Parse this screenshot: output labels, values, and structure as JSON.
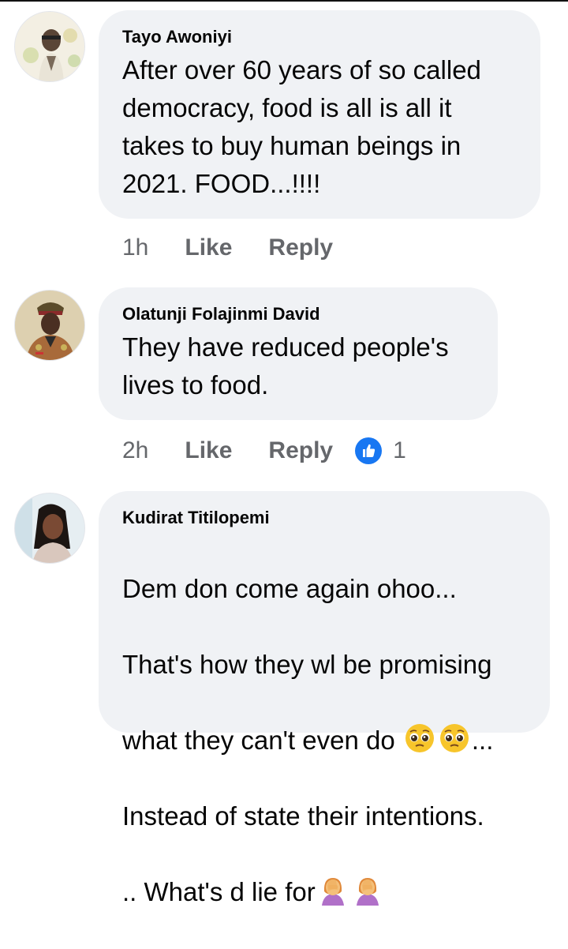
{
  "comments": [
    {
      "author": "Tayo Awoniyi",
      "text": "After over 60 years of so called\ndemocracy, food is all is all it\ntakes to buy human beings in\n2021. FOOD...!!!!",
      "time": "1h",
      "like_label": "Like",
      "reply_label": "Reply"
    },
    {
      "author": "Olatunji Folajinmi David",
      "text": "They have reduced people's\nlives to food.",
      "time": "2h",
      "like_label": "Like",
      "reply_label": "Reply",
      "reaction_count": "1"
    },
    {
      "author": "Kudirat Titilopemi",
      "line1": "Dem don come again ohoo...",
      "line2": "That's how they wl be promising",
      "line3a": "what they can't even do ",
      "line3b": "...",
      "line4": "Instead of state their intentions.",
      "line5": ".. What's d lie for"
    }
  ],
  "colors": {
    "bubble": "#f0f2f5",
    "action_text": "#65676b",
    "like_blue": "#1877f2"
  },
  "icons": {
    "reaction": "like-thumb-icon",
    "emoji_sad": "pleading-face-emoji",
    "emoji_facepalm": "woman-facepalming-emoji"
  }
}
